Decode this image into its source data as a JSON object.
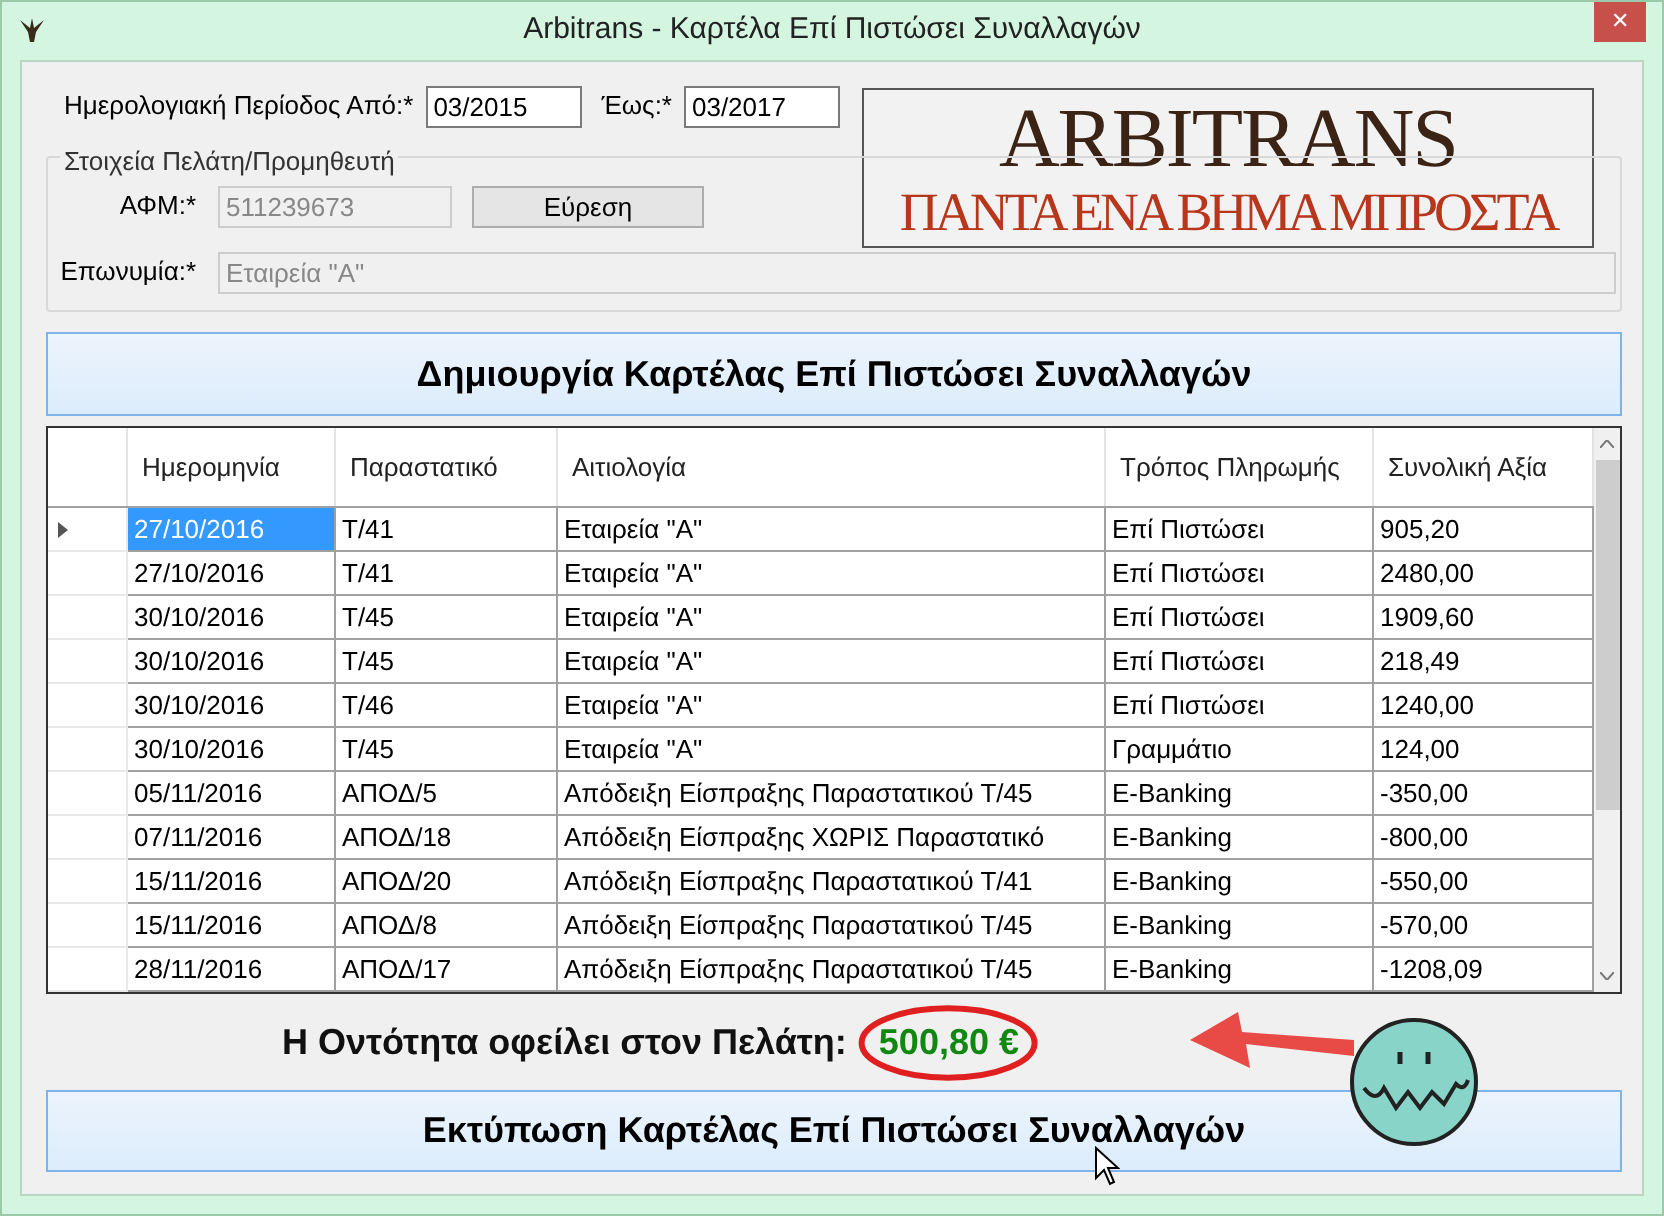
{
  "window": {
    "title": "Arbitrans - Καρτέλα Επί Πιστώσει Συναλλαγών",
    "close": "✕"
  },
  "period": {
    "from_label": "Ημερολογιακή Περίοδος Από:*",
    "from_value": "03/2015",
    "to_label": "Έως:*",
    "to_value": "03/2017"
  },
  "logo": {
    "name": "ARBITRANS",
    "slogan": "ΠΑΝΤΑ ΕΝΑ ΒΗΜΑ ΜΠΡΟΣΤΑ"
  },
  "customer": {
    "group_title": "Στοιχεία Πελάτη/Προμηθευτή",
    "afm_label": "ΑΦΜ:*",
    "afm_value": "511239673",
    "find_button": "Εύρεση",
    "name_label": "Επωνυμία:*",
    "name_value": "Εταιρεία \"Α\""
  },
  "create_button": "Δημιουργία Καρτέλας Επί Πιστώσει Συναλλαγών",
  "table": {
    "columns": [
      "Ημερομηνία",
      "Παραστατικό",
      "Αιτιολογία",
      "Τρόπος Πληρωμής",
      "Συνολική Αξία"
    ],
    "rows": [
      {
        "selected": true,
        "cells": [
          "27/10/2016",
          "Τ/41",
          "Εταιρεία \"Α\"",
          "Επί Πιστώσει",
          "905,20"
        ]
      },
      {
        "selected": false,
        "cells": [
          "27/10/2016",
          "Τ/41",
          "Εταιρεία \"Α\"",
          "Επί Πιστώσει",
          "2480,00"
        ]
      },
      {
        "selected": false,
        "cells": [
          "30/10/2016",
          "Τ/45",
          "Εταιρεία \"Α\"",
          "Επί Πιστώσει",
          "1909,60"
        ]
      },
      {
        "selected": false,
        "cells": [
          "30/10/2016",
          "Τ/45",
          "Εταιρεία \"Α\"",
          "Επί Πιστώσει",
          "218,49"
        ]
      },
      {
        "selected": false,
        "cells": [
          "30/10/2016",
          "Τ/46",
          "Εταιρεία \"Α\"",
          "Επί Πιστώσει",
          "1240,00"
        ]
      },
      {
        "selected": false,
        "cells": [
          "30/10/2016",
          "Τ/45",
          "Εταιρεία \"Α\"",
          "Γραμμάτιο",
          "124,00"
        ]
      },
      {
        "selected": false,
        "cells": [
          "05/11/2016",
          "ΑΠΟΔ/5",
          "Απόδειξη Είσπραξης Παραστατικού Τ/45",
          "E-Banking",
          "-350,00"
        ]
      },
      {
        "selected": false,
        "cells": [
          "07/11/2016",
          "ΑΠΟΔ/18",
          "Απόδειξη Είσπραξης ΧΩΡΙΣ Παραστατικό",
          "E-Banking",
          "-800,00"
        ]
      },
      {
        "selected": false,
        "cells": [
          "15/11/2016",
          "ΑΠΟΔ/20",
          "Απόδειξη Είσπραξης Παραστατικού Τ/41",
          "E-Banking",
          "-550,00"
        ]
      },
      {
        "selected": false,
        "cells": [
          "15/11/2016",
          "ΑΠΟΔ/8",
          "Απόδειξη Είσπραξης Παραστατικού Τ/45",
          "E-Banking",
          "-570,00"
        ]
      },
      {
        "selected": false,
        "cells": [
          "28/11/2016",
          "ΑΠΟΔ/17",
          "Απόδειξη Είσπραξης Παραστατικού Τ/45",
          "E-Banking",
          "-1208,09"
        ]
      }
    ]
  },
  "balance": {
    "label": "Η Οντότητα οφείλει στον Πελάτη:",
    "amount": "500,80 €"
  },
  "print_button": "Εκτύπωση Καρτέλας Επί Πιστώσει Συναλλαγών"
}
